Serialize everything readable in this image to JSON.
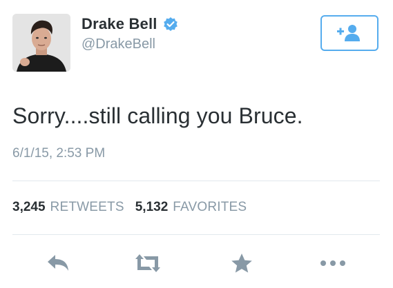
{
  "user": {
    "display_name": "Drake Bell",
    "handle": "@DrakeBell",
    "verified": true,
    "avatar_icon": "profile-photo"
  },
  "follow_button": {
    "icon": "add-user-icon",
    "accent_color": "#55acee"
  },
  "tweet": {
    "text": "Sorry....still calling you Bruce.",
    "timestamp": "6/1/15, 2:53 PM"
  },
  "stats": {
    "retweets_count": "3,245",
    "retweets_label": "RETWEETS",
    "favorites_count": "5,132",
    "favorites_label": "FAVORITES"
  },
  "actions": [
    {
      "icon": "reply-icon"
    },
    {
      "icon": "retweet-icon"
    },
    {
      "icon": "favorite-star-icon"
    },
    {
      "icon": "more-dots-icon"
    }
  ],
  "colors": {
    "text_primary": "#292f33",
    "text_secondary": "#8899a6",
    "verified_blue": "#55acee",
    "icon_gray": "#8899a6",
    "divider": "#e1e8ed"
  }
}
